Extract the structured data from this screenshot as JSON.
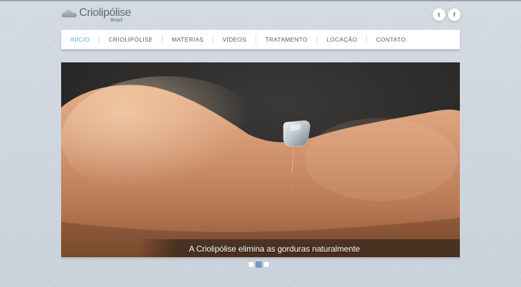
{
  "brand": {
    "name": "Criolipólise",
    "subtitle": "Brasil"
  },
  "social": [
    {
      "icon": "twitter-icon",
      "glyph": "t"
    },
    {
      "icon": "facebook-icon",
      "glyph": "f"
    }
  ],
  "nav": {
    "items": [
      {
        "label": "INÍCIO",
        "active": true
      },
      {
        "label": "CRIOLIPÓLISE",
        "active": false
      },
      {
        "label": "MATÉRIAS",
        "active": false
      },
      {
        "label": "VÍDEOS",
        "active": false
      },
      {
        "label": "TRATAMENTO",
        "active": false
      },
      {
        "label": "LOCAÇÃO",
        "active": false
      },
      {
        "label": "CONTATO",
        "active": false
      }
    ]
  },
  "slider": {
    "caption": "A Criolipólise elimina as gorduras naturalmente",
    "slide_count": 3,
    "active_slide": 2
  },
  "colors": {
    "accent": "#5aa6d6",
    "page_bg": "#cdd5de",
    "pager_active": "#6f9ac4"
  }
}
